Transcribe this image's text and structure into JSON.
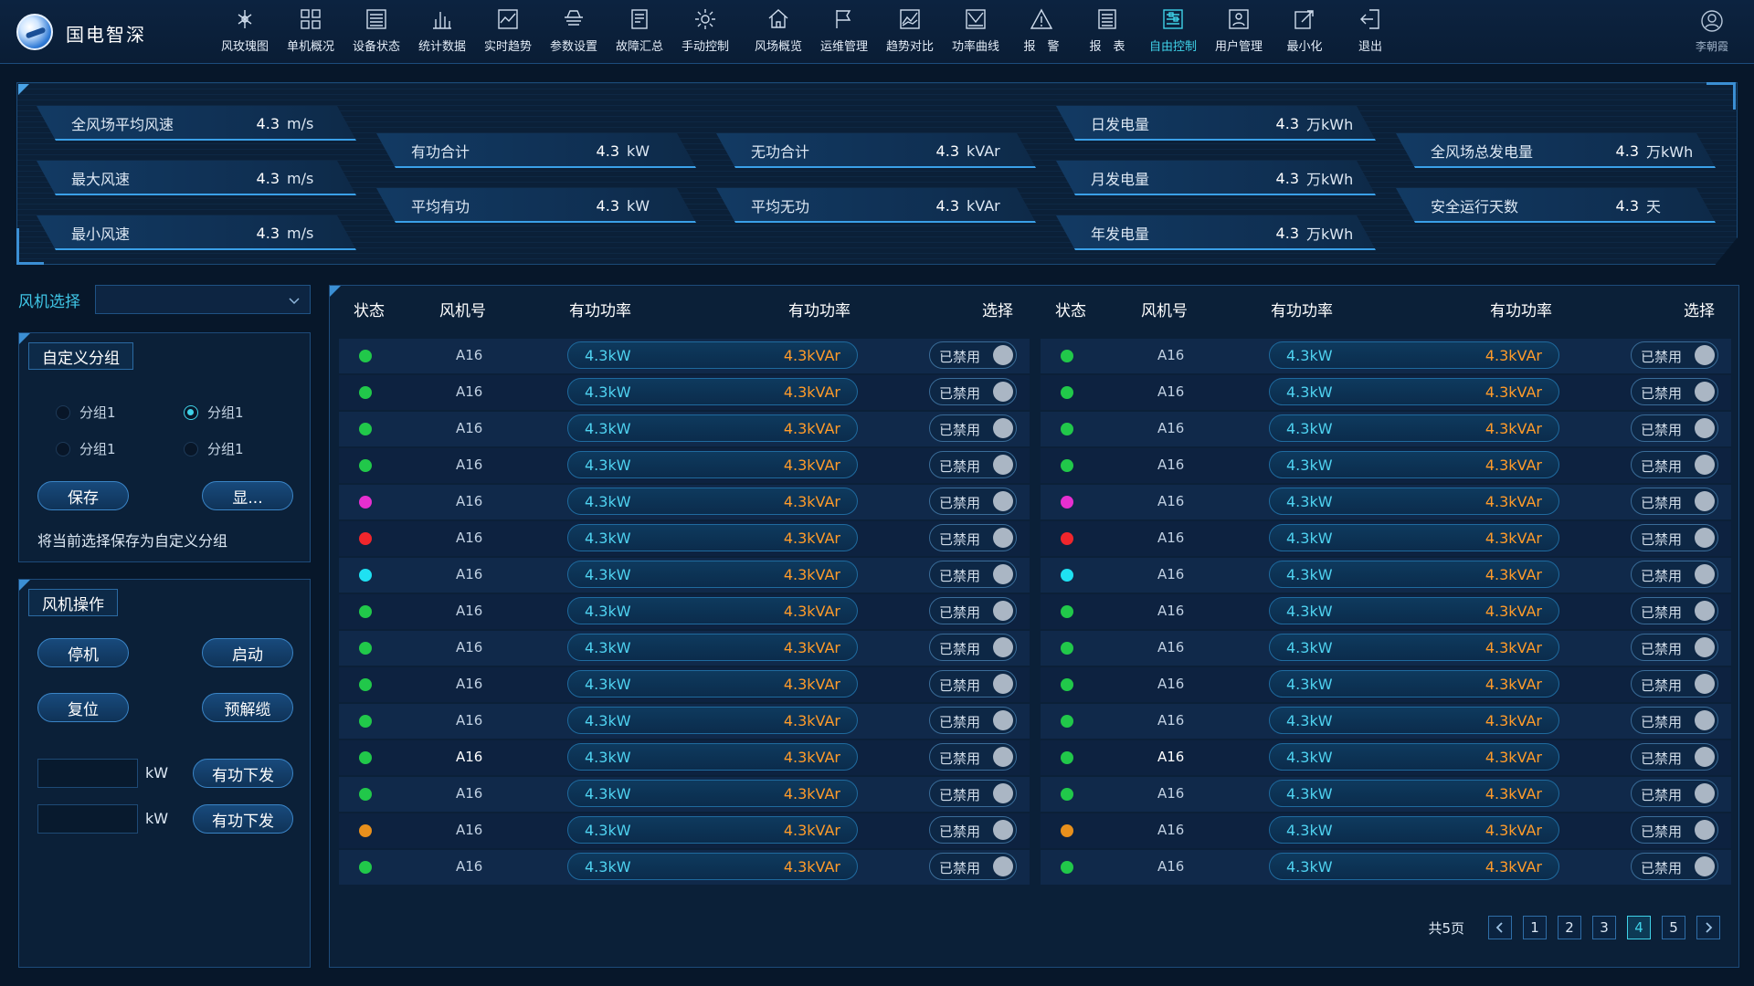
{
  "app": {
    "title": "国电智深",
    "user": "李朝霞"
  },
  "nav": [
    {
      "label": "风玫瑰图",
      "icon": "wind-rose-icon"
    },
    {
      "label": "单机概况",
      "icon": "grid-icon"
    },
    {
      "label": "设备状态",
      "icon": "device-status-icon"
    },
    {
      "label": "统计数据",
      "icon": "bar-chart-icon"
    },
    {
      "label": "实时趋势",
      "icon": "trend-icon"
    },
    {
      "label": "参数设置",
      "icon": "parameter-icon"
    },
    {
      "label": "故障汇总",
      "icon": "fault-list-icon"
    },
    {
      "label": "手动控制",
      "icon": "gear-icon"
    },
    {
      "label": "风场概览",
      "icon": "home-icon"
    },
    {
      "label": "运维管理",
      "icon": "flag-icon"
    },
    {
      "label": "趋势对比",
      "icon": "compare-icon"
    },
    {
      "label": "功率曲线",
      "icon": "power-curve-icon"
    },
    {
      "label": "报　警",
      "icon": "warning-icon"
    },
    {
      "label": "报　表",
      "icon": "report-icon"
    },
    {
      "label": "自由控制",
      "icon": "free-control-icon",
      "active": true
    },
    {
      "label": "用户管理",
      "icon": "user-manage-icon"
    },
    {
      "label": "最小化",
      "icon": "minimize-icon"
    },
    {
      "label": "退出",
      "icon": "exit-icon"
    }
  ],
  "stats": {
    "avg_wind": {
      "label": "全风场平均风速",
      "value": "4.3",
      "unit": "m/s"
    },
    "max_wind": {
      "label": "最大风速",
      "value": "4.3",
      "unit": "m/s"
    },
    "min_wind": {
      "label": "最小风速",
      "value": "4.3",
      "unit": "m/s"
    },
    "active_sum": {
      "label": "有功合计",
      "value": "4.3",
      "unit": "kW"
    },
    "avg_active": {
      "label": "平均有功",
      "value": "4.3",
      "unit": "kW"
    },
    "reactive_sum": {
      "label": "无功合计",
      "value": "4.3",
      "unit": "kVAr"
    },
    "avg_reactive": {
      "label": "平均无功",
      "value": "4.3",
      "unit": "kVAr"
    },
    "day_energy": {
      "label": "日发电量",
      "value": "4.3",
      "unit": "万kWh"
    },
    "month_energy": {
      "label": "月发电量",
      "value": "4.3",
      "unit": "万kWh"
    },
    "year_energy": {
      "label": "年发电量",
      "value": "4.3",
      "unit": "万kWh"
    },
    "total_energy": {
      "label": "全风场总发电量",
      "value": "4.3",
      "unit": "万kWh"
    },
    "safe_days": {
      "label": "安全运行天数",
      "value": "4.3",
      "unit": "天"
    }
  },
  "fan_select": {
    "label": "风机选择",
    "value": ""
  },
  "custom_group": {
    "title": "自定义分组",
    "options": [
      {
        "label": "分组1",
        "checked": false
      },
      {
        "label": "分组1",
        "checked": true
      },
      {
        "label": "分组1",
        "checked": false
      },
      {
        "label": "分组1",
        "checked": false
      }
    ],
    "save_label": "保存",
    "show_label": "显...",
    "note": "将当前选择保存为自定义分组"
  },
  "fan_ops": {
    "title": "风机操作",
    "stop": "停机",
    "start": "启动",
    "reset": "复位",
    "unwind": "预解缆",
    "unit1": "kW",
    "unit2": "kW",
    "send1": "有功下发",
    "send2": "有功下发"
  },
  "table": {
    "headers": [
      "状态",
      "风机号",
      "有功功率",
      "有功功率",
      "选择"
    ],
    "rows": [
      {
        "status": "#21c84a",
        "fan": "A16",
        "kw": "4.3kW",
        "kvar": "4.3kVAr",
        "toggle": "已禁用"
      },
      {
        "status": "#21c84a",
        "fan": "A16",
        "kw": "4.3kW",
        "kvar": "4.3kVAr",
        "toggle": "已禁用"
      },
      {
        "status": "#21c84a",
        "fan": "A16",
        "kw": "4.3kW",
        "kvar": "4.3kVAr",
        "toggle": "已禁用"
      },
      {
        "status": "#21c84a",
        "fan": "A16",
        "kw": "4.3kW",
        "kvar": "4.3kVAr",
        "toggle": "已禁用"
      },
      {
        "status": "#e62fd0",
        "fan": "A16",
        "kw": "4.3kW",
        "kvar": "4.3kVAr",
        "toggle": "已禁用"
      },
      {
        "status": "#f0262c",
        "fan": "A16",
        "kw": "4.3kW",
        "kvar": "4.3kVAr",
        "toggle": "已禁用"
      },
      {
        "status": "#1fe1f2",
        "fan": "A16",
        "kw": "4.3kW",
        "kvar": "4.3kVAr",
        "toggle": "已禁用"
      },
      {
        "status": "#21c84a",
        "fan": "A16",
        "kw": "4.3kW",
        "kvar": "4.3kVAr",
        "toggle": "已禁用"
      },
      {
        "status": "#21c84a",
        "fan": "A16",
        "kw": "4.3kW",
        "kvar": "4.3kVAr",
        "toggle": "已禁用"
      },
      {
        "status": "#21c84a",
        "fan": "A16",
        "kw": "4.3kW",
        "kvar": "4.3kVAr",
        "toggle": "已禁用"
      },
      {
        "status": "#21c84a",
        "fan": "A16",
        "kw": "4.3kW",
        "kvar": "4.3kVAr",
        "toggle": "已禁用"
      },
      {
        "status": "#21c84a",
        "fan": "A16",
        "kw": "4.3kW",
        "kvar": "4.3kVAr",
        "toggle": "已禁用",
        "highlight": true
      },
      {
        "status": "#21c84a",
        "fan": "A16",
        "kw": "4.3kW",
        "kvar": "4.3kVAr",
        "toggle": "已禁用"
      },
      {
        "status": "#e8901c",
        "fan": "A16",
        "kw": "4.3kW",
        "kvar": "4.3kVAr",
        "toggle": "已禁用"
      },
      {
        "status": "#21c84a",
        "fan": "A16",
        "kw": "4.3kW",
        "kvar": "4.3kVAr",
        "toggle": "已禁用"
      }
    ]
  },
  "pager": {
    "total": "共5页",
    "pages": [
      "1",
      "2",
      "3",
      "4",
      "5"
    ],
    "current": "4"
  }
}
